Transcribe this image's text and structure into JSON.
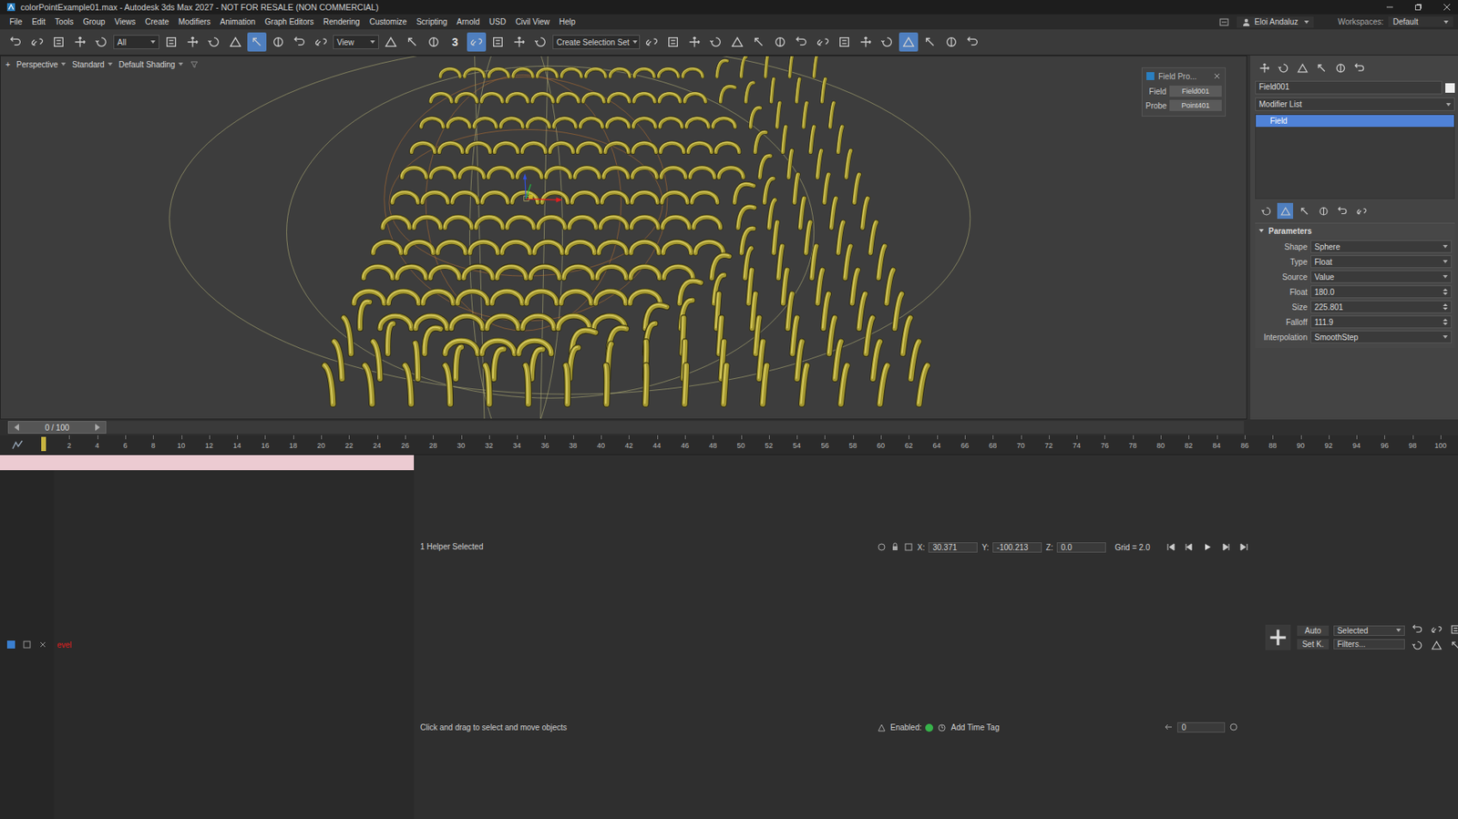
{
  "window": {
    "title": "colorPointExample01.max - Autodesk 3ds Max 2027 - NOT FOR RESALE (NON COMMERCIAL)"
  },
  "menu": [
    "File",
    "Edit",
    "Tools",
    "Group",
    "Views",
    "Create",
    "Modifiers",
    "Animation",
    "Graph Editors",
    "Rendering",
    "Customize",
    "Scripting",
    "Arnold",
    "USD",
    "Civil View",
    "Help"
  ],
  "account": {
    "user": "Eloi Andaluz",
    "workspaces_label": "Workspaces:",
    "workspace": "Default"
  },
  "toolbar": {
    "selection_filter": "All",
    "reference_coord": "View",
    "selection_set": "Create Selection Set",
    "snaps_label": "3",
    "group_a": [
      {
        "active": false
      },
      {
        "active": false
      },
      {
        "active": false
      },
      {
        "active": false
      },
      {
        "active": false
      }
    ],
    "group_b": [
      {
        "active": false
      },
      {
        "active": false
      },
      {
        "active": false
      },
      {
        "active": false
      },
      {
        "active": true
      },
      {
        "active": false
      },
      {
        "active": false
      },
      {
        "active": false
      }
    ],
    "group_c": [
      {
        "active": false
      },
      {
        "active": false
      },
      {
        "active": false
      },
      {
        "active": false
      },
      {
        "active": true
      },
      {
        "active": false
      },
      {
        "active": false
      },
      {
        "active": false
      }
    ],
    "group_d": [
      {
        "active": false
      },
      {
        "active": false
      },
      {
        "active": false
      },
      {
        "active": false
      },
      {
        "active": false
      },
      {
        "active": false
      },
      {
        "active": false
      },
      {
        "active": false
      },
      {
        "active": false
      },
      {
        "active": false
      },
      {
        "active": false
      },
      {
        "active": false
      },
      {
        "active": true
      },
      {
        "active": false
      },
      {
        "active": false
      },
      {
        "active": false
      }
    ]
  },
  "viewport": {
    "labels": [
      "+",
      "Perspective",
      "Standard",
      "Default Shading"
    ]
  },
  "field_dialog": {
    "title": "Field Pro...",
    "rows": [
      {
        "label": "Field",
        "value": "Field001"
      },
      {
        "label": "Probe",
        "value": "Point401"
      }
    ]
  },
  "command_panel": {
    "object_name": "Field001",
    "modifier_list": "Modifier List",
    "stack": [
      {
        "label": "Field",
        "selected": true
      }
    ],
    "stack_tools": [
      {
        "active": false
      },
      {
        "active": true
      },
      {
        "active": false
      },
      {
        "active": false
      },
      {
        "active": false
      },
      {
        "active": false
      }
    ],
    "rollout": {
      "title": "Parameters",
      "expanded": true
    },
    "params": [
      {
        "label": "Shape",
        "value": "Sphere",
        "kind": "dropdown"
      },
      {
        "label": "Type",
        "value": "Float",
        "kind": "dropdown"
      },
      {
        "label": "Source",
        "value": "Value",
        "kind": "dropdown"
      },
      {
        "label": "Float",
        "value": "180.0",
        "kind": "spinner"
      },
      {
        "label": "Size",
        "value": "225.801",
        "kind": "spinner"
      },
      {
        "label": "Falloff",
        "value": "111.9",
        "kind": "spinner"
      },
      {
        "label": "Interpolation",
        "value": "SmoothStep",
        "kind": "dropdown"
      }
    ]
  },
  "timeline": {
    "frame_label": "0 / 100",
    "level": 0,
    "ticks": [
      "2",
      "4",
      "6",
      "8",
      "10",
      "12",
      "14",
      "16",
      "18",
      "20",
      "22",
      "24",
      "26",
      "28",
      "30",
      "32",
      "34",
      "36",
      "38",
      "40",
      "42",
      "44",
      "46",
      "48",
      "50",
      "52",
      "54",
      "56",
      "58",
      "60",
      "62",
      "64",
      "66",
      "68",
      "70",
      "72",
      "74",
      "76",
      "78",
      "80",
      "82",
      "84",
      "86",
      "88",
      "90",
      "92",
      "94",
      "96",
      "98",
      "100"
    ]
  },
  "status": {
    "listener": "evel",
    "selection": "1 Helper Selected",
    "prompt": "Click and drag to select and move objects",
    "coords": [
      {
        "axis": "X:",
        "value": "30.371"
      },
      {
        "axis": "Y:",
        "value": "-100.213"
      },
      {
        "axis": "Z:",
        "value": "0.0"
      }
    ],
    "grid": "Grid = 2.0",
    "enabled_label": "Enabled:",
    "enabled": true,
    "add_time_tag": "Add Time Tag",
    "current_frame": "0",
    "auto_key": "Auto",
    "key_filter": "Selected",
    "set_key": "Set K.",
    "filters": "Filters..."
  }
}
